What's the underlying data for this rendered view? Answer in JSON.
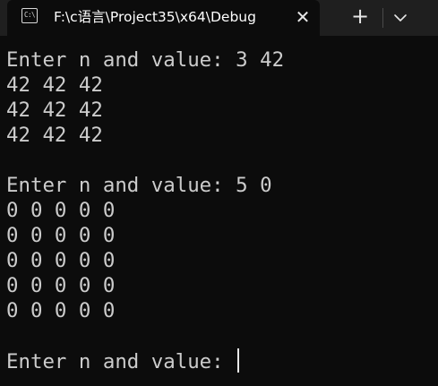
{
  "window": {
    "tab_title": "F:\\c语言\\Project35\\x64\\Debug",
    "tab_icon_text": "C:\\",
    "close_glyph": "✕",
    "new_tab_glyph": "+",
    "icons": [
      "terminal-icon",
      "close-icon",
      "plus-icon",
      "chevron-down-icon"
    ]
  },
  "console": {
    "lines": [
      "Enter n and value: 3 42",
      "42 42 42",
      "42 42 42",
      "42 42 42",
      "",
      "Enter n and value: 5 0",
      "0 0 0 0 0",
      "0 0 0 0 0",
      "0 0 0 0 0",
      "0 0 0 0 0",
      "0 0 0 0 0",
      "",
      "Enter n and value: "
    ],
    "colors": {
      "background": "#0c0c0c",
      "text": "#cccccc",
      "titlebar": "#1f1f1f"
    }
  }
}
